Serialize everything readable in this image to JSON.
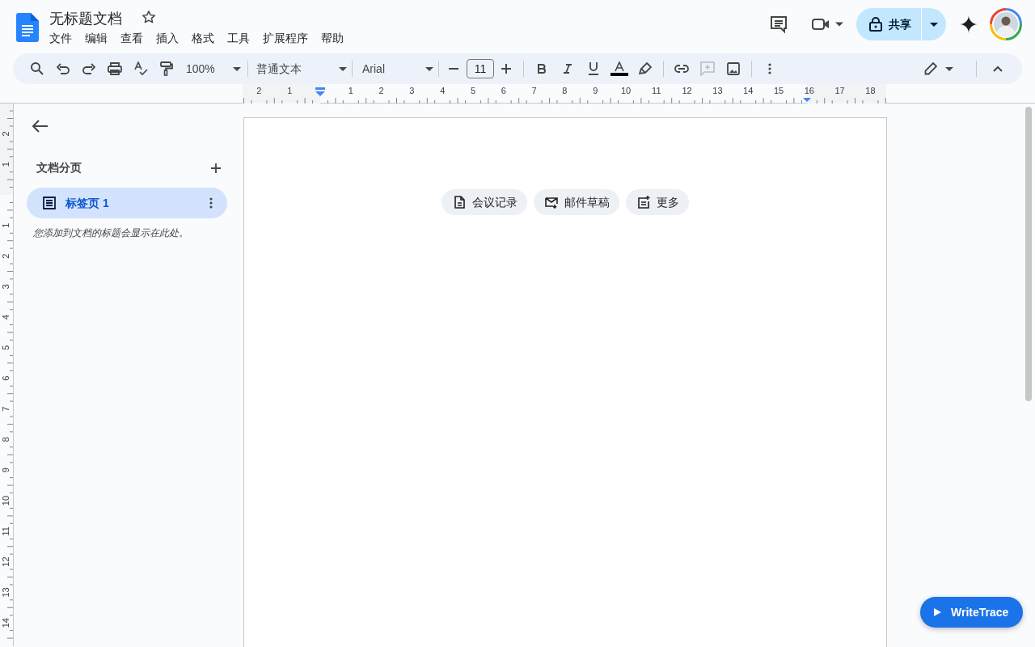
{
  "document": {
    "title": "无标题文档",
    "starred": false
  },
  "menu": [
    "文件",
    "编辑",
    "查看",
    "插入",
    "格式",
    "工具",
    "扩展程序",
    "帮助"
  ],
  "share_button": {
    "label": "共享"
  },
  "toolbar": {
    "zoom": "100%",
    "paragraph_style": "普通文本",
    "font": "Arial",
    "font_size": "11",
    "add_comment_disabled": true
  },
  "ruler": {
    "horizontal_before": [
      "2",
      "1"
    ],
    "horizontal_after": [
      "1",
      "2",
      "3",
      "4",
      "5",
      "6",
      "7",
      "8",
      "9",
      "10",
      "11",
      "12",
      "13",
      "14",
      "15",
      "16",
      "17",
      "18"
    ],
    "vertical_before": [
      "2",
      "1"
    ],
    "vertical_after": [
      "1",
      "2",
      "3",
      "4",
      "5",
      "6",
      "7",
      "8",
      "9",
      "10",
      "11",
      "12",
      "13",
      "14"
    ]
  },
  "sidebar": {
    "title": "文档分页",
    "tabs": [
      {
        "label": "标签页 1",
        "selected": true
      }
    ],
    "hint": "您添加到文档的标题会显示在此处。"
  },
  "chips": [
    {
      "label": "会议记录"
    },
    {
      "label": "邮件草稿"
    },
    {
      "label": "更多"
    }
  ],
  "extension_button": {
    "label": "WriteTrace"
  }
}
